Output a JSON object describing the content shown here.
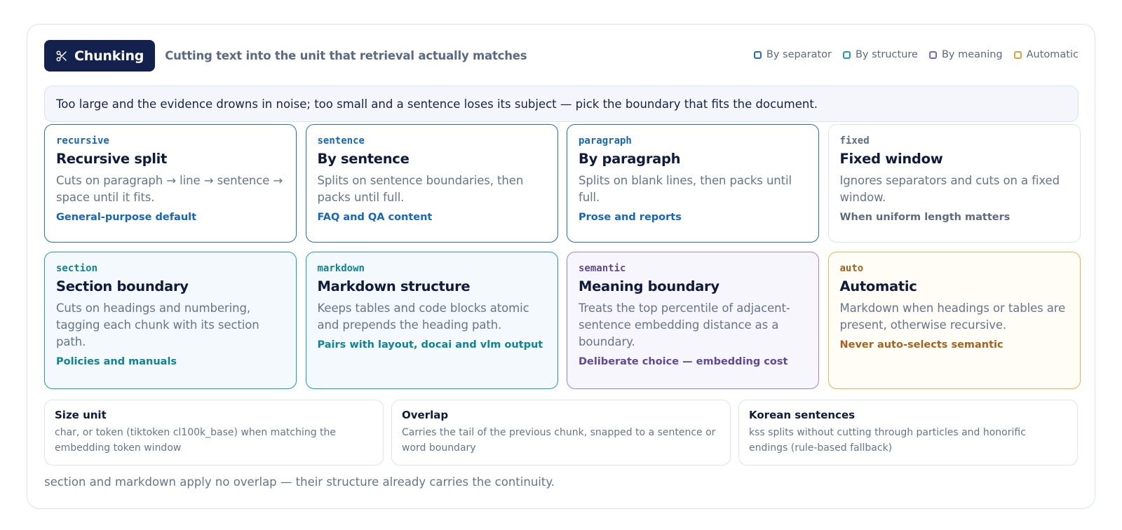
{
  "header": {
    "badge_icon": "scissors-icon",
    "title": "Chunking",
    "subtitle": "Cutting text into the unit that retrieval actually matches"
  },
  "legend": [
    {
      "label": "By separator",
      "color": "#1f6fd0"
    },
    {
      "label": "By structure",
      "color": "#19a0b6"
    },
    {
      "label": "By meaning",
      "color": "#7a64c4"
    },
    {
      "label": "Automatic",
      "color": "#d9a13a"
    }
  ],
  "intro": "Too large and the evidence drowns in noise; too small and a sentence loses its subject — pick the boundary that fits the document.",
  "cards": [
    {
      "code": "recursive",
      "name": "Recursive split",
      "desc": "Cuts on paragraph → line → sentence → space until it fits.",
      "note": "General-purpose default",
      "group": "separator"
    },
    {
      "code": "sentence",
      "name": "By sentence",
      "desc": "Splits on sentence boundaries, then packs until full.",
      "note": "FAQ and QA content",
      "group": "separator"
    },
    {
      "code": "paragraph",
      "name": "By paragraph",
      "desc": "Splits on blank lines, then packs until full.",
      "note": "Prose and reports",
      "group": "separator"
    },
    {
      "code": "fixed",
      "name": "Fixed window",
      "desc": "Ignores separators and cuts on a fixed window.",
      "note": "When uniform length matters",
      "group": "none"
    },
    {
      "code": "section",
      "name": "Section boundary",
      "desc": "Cuts on headings and numbering, tagging each chunk with its section path.",
      "note": "Policies and manuals",
      "group": "structure"
    },
    {
      "code": "markdown",
      "name": "Markdown structure",
      "desc": "Keeps tables and code blocks atomic and prepends the heading path.",
      "note": "Pairs with layout, docai and vlm output",
      "group": "structure"
    },
    {
      "code": "semantic",
      "name": "Meaning boundary",
      "desc": "Treats the top percentile of adjacent-sentence embedding distance as a boundary.",
      "note": "Deliberate choice — embedding cost",
      "group": "meaning"
    },
    {
      "code": "auto",
      "name": "Automatic",
      "desc": "Markdown when headings or tables are present, otherwise recursive.",
      "note": "Never auto-selects semantic",
      "group": "automatic"
    }
  ],
  "facts": [
    {
      "name": "Size unit",
      "desc": "char, or token (tiktoken cl100k_base) when matching the embedding token window"
    },
    {
      "name": "Overlap",
      "desc": "Carries the tail of the previous chunk, snapped to a sentence or word boundary"
    },
    {
      "name": "Korean sentences",
      "desc": "kss splits without cutting through particles and honorific endings (rule-based fallback)"
    }
  ],
  "footer": "section and markdown apply no overlap — their structure already carries the continuity."
}
